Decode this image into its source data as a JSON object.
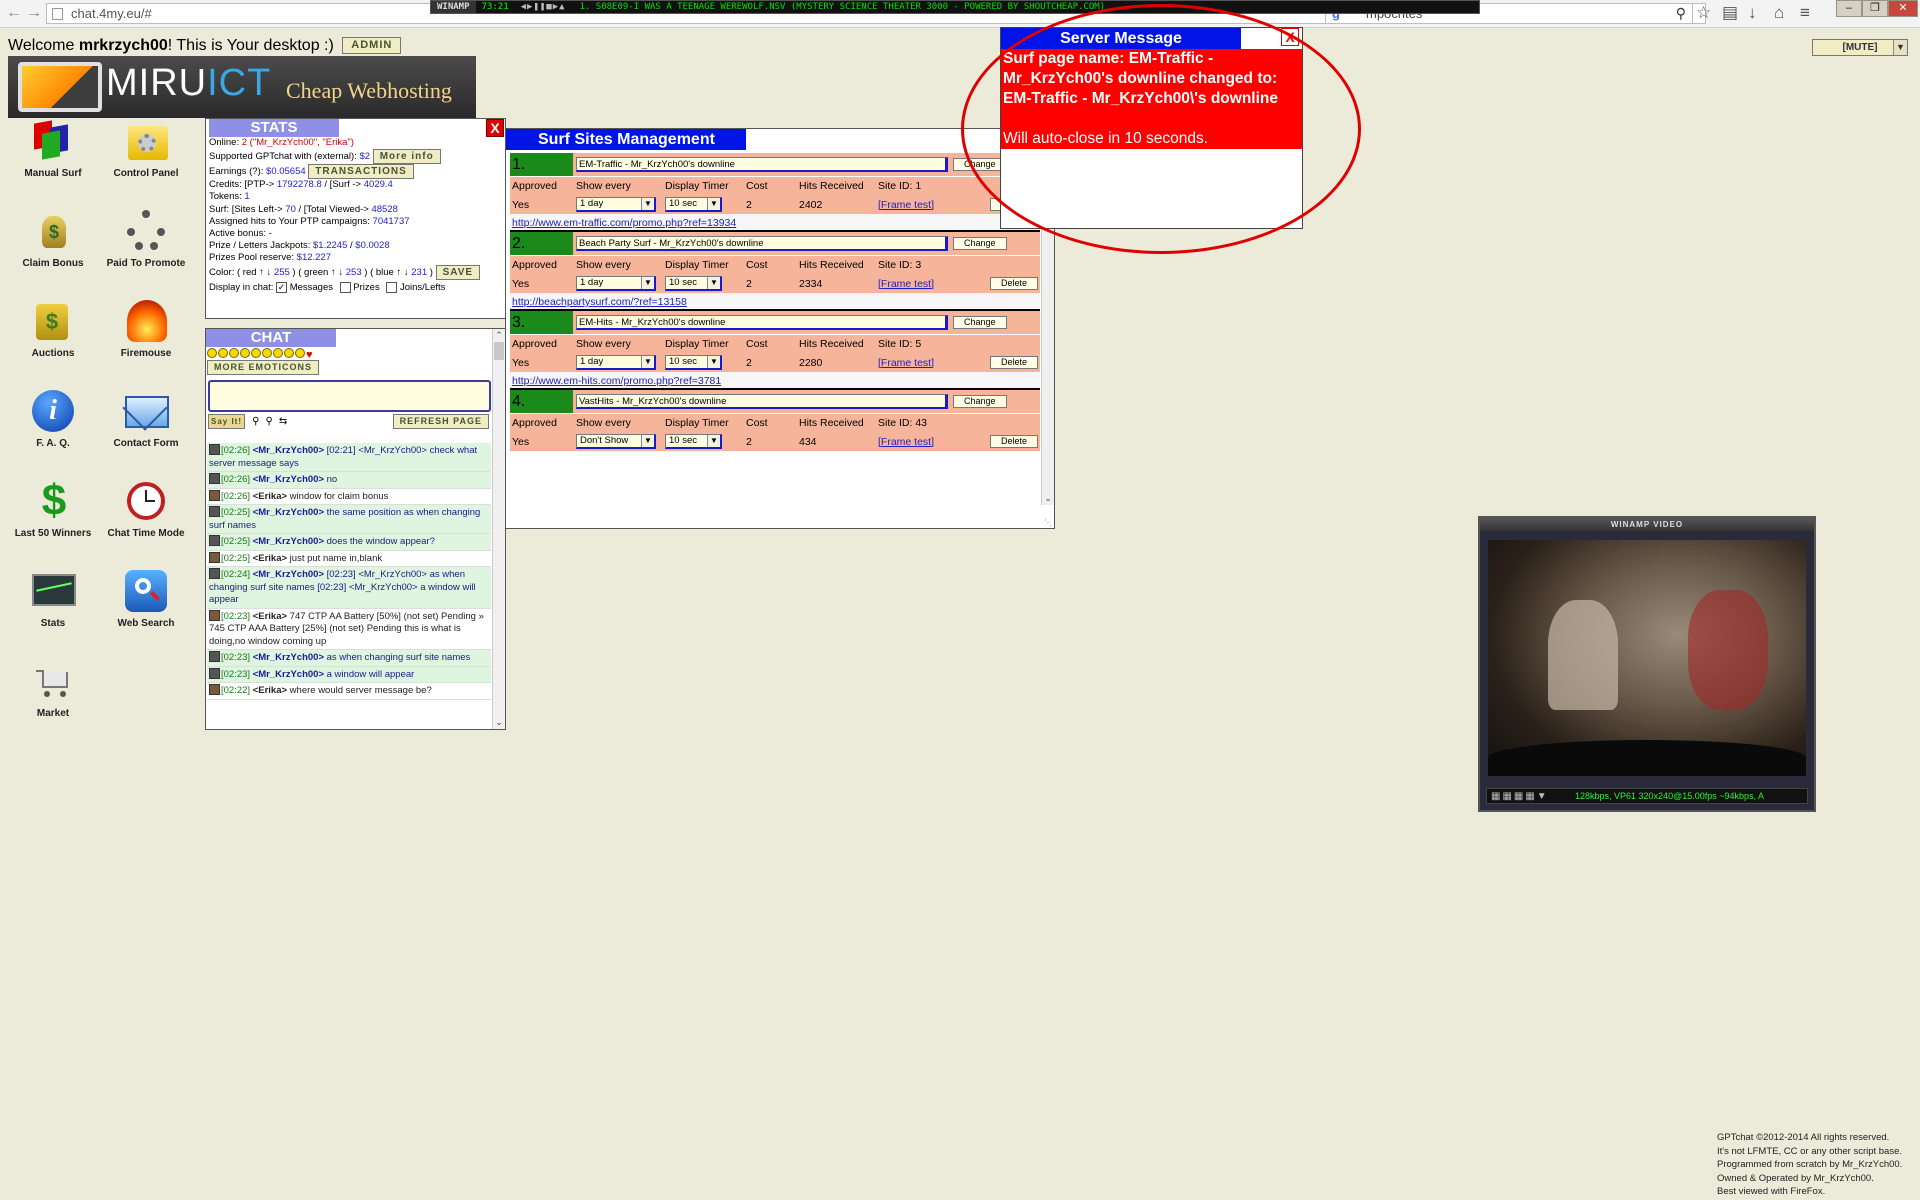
{
  "browser": {
    "url": "chat.4my.eu/#",
    "search_value": "mpochtes"
  },
  "winamp_bar": {
    "label": "WINAMP",
    "time": "73:21",
    "song": "1. S08E09-I WAS A TEENAGE WEREWOLF.NSV (MYSTERY SCIENCE THEATER 3000 - POWERED BY SHOUTCHEAP.COM)"
  },
  "header": {
    "welcome_prefix": "Welcome ",
    "username": "mrkrzych00",
    "welcome_suffix": "! This is Your desktop :)",
    "admin_label": "ADMIN",
    "mute_label": "[MUTE]"
  },
  "logo": {
    "brand_a": "MIRU",
    "brand_b": "ICT",
    "tagline": "Cheap Webhosting"
  },
  "desktop_icons": [
    {
      "label": "Manual Surf",
      "icon": "flags-icon"
    },
    {
      "label": "Control Panel",
      "icon": "folder-gear-icon"
    },
    {
      "label": "Claim Bonus",
      "icon": "money-bag-icon"
    },
    {
      "label": "Paid To Promote",
      "icon": "network-people-icon"
    },
    {
      "label": "Auctions",
      "icon": "auction-money-icon"
    },
    {
      "label": "Firemouse",
      "icon": "fire-icon"
    },
    {
      "label": "F. A. Q.",
      "icon": "info-icon"
    },
    {
      "label": "Contact Form",
      "icon": "envelope-icon"
    },
    {
      "label": "Last 50 Winners",
      "icon": "dollar-icon"
    },
    {
      "label": "Chat Time Mode",
      "icon": "alarm-clock-icon"
    },
    {
      "label": "Stats",
      "icon": "chart-monitor-icon"
    },
    {
      "label": "Web Search",
      "icon": "web-search-icon"
    },
    {
      "label": "Market",
      "icon": "cart-icon"
    }
  ],
  "stats": {
    "title": "STATS",
    "online_label": "Online: ",
    "online_count": "2",
    "online_users": " (\"Mr_KrzYch00\", \"Erika\")",
    "supported_label": "Supported GPTchat with (external): ",
    "supported_value": "$2",
    "more_info_label": "More info",
    "earnings_label": "Earnings (?): ",
    "earnings_value": "$0.05654",
    "transactions_label": "TRANSACTIONS",
    "credits_label": "Credits: [PTP-> ",
    "credits_ptp": "1792278.8",
    "credits_mid": " / [Surf -> ",
    "credits_surf": "4029.4",
    "tokens_label": "Tokens: ",
    "tokens_value": "1",
    "surf_label": "Surf: [Sites Left-> ",
    "sites_left": "70",
    "total_viewed_label": " / [Total Viewed-> ",
    "total_viewed": "48528",
    "assigned_label": "Assigned hits to Your PTP campaigns: ",
    "assigned_value": "7041737",
    "active_bonus": "Active bonus: -",
    "jackpot_label": "Prize / Letters Jackpots: ",
    "jackpot_prize": "$1.2245",
    "jackpot_sep": " / ",
    "jackpot_letters": "$0.0028",
    "pool_label": "Prizes Pool reserve: ",
    "pool_value": "$12.227",
    "color_label": "Color: ( red ↑ ↓ ",
    "red_value": "255",
    "green_label": " ) ( green ↑ ↓ ",
    "green_value": "253",
    "blue_label": " ) ( blue ↑ ↓ ",
    "blue_value": "231",
    "color_end": " )",
    "save_label": "SAVE",
    "display_label": "Display in chat: ",
    "messages_label": "Messages",
    "prizes_label": "Prizes",
    "joins_label": "Joins/Lefts",
    "messages_checked": true,
    "prizes_checked": false,
    "joins_checked": false
  },
  "chat": {
    "title": "CHAT",
    "more_emoticons_label": "MORE EMOTICONS",
    "say_label": "Say It!",
    "refresh_label": "REFRESH PAGE",
    "messages": [
      {
        "time": "[02:26]",
        "user": "<Mr_KrzYch00>",
        "text": " [02:21] <Mr_KrzYch00> check what server message says",
        "bg": "green",
        "self": true
      },
      {
        "time": "[02:26]",
        "user": "<Mr_KrzYch00>",
        "text": " no",
        "bg": "green",
        "self": true
      },
      {
        "time": "[02:26]",
        "user": "<Erika>",
        "text": " window for claim bonus",
        "bg": "white",
        "self": false
      },
      {
        "time": "[02:25]",
        "user": "<Mr_KrzYch00>",
        "text": " the same position as when changing surf names",
        "bg": "green",
        "self": true
      },
      {
        "time": "[02:25]",
        "user": "<Mr_KrzYch00>",
        "text": " does the window appear?",
        "bg": "green",
        "self": true
      },
      {
        "time": "[02:25]",
        "user": "<Erika>",
        "text": " just put name in,blank",
        "bg": "white",
        "self": false
      },
      {
        "time": "[02:24]",
        "user": "<Mr_KrzYch00>",
        "text": " [02:23] <Mr_KrzYch00> as when changing surf site names [02:23] <Mr_KrzYch00> a window will appear",
        "bg": "green",
        "self": true
      },
      {
        "time": "[02:23]",
        "user": "<Erika>",
        "text": " 747 CTP AA Battery [50%] (not set) Pending » 745 CTP AAA Battery [25%] (not set) Pending this is what is doing,no window coming up",
        "bg": "white",
        "self": false
      },
      {
        "time": "[02:23]",
        "user": "<Mr_KrzYch00>",
        "text": " as when changing surf site names",
        "bg": "green",
        "self": true
      },
      {
        "time": "[02:23]",
        "user": "<Mr_KrzYch00>",
        "text": " a window will appear",
        "bg": "green",
        "self": true
      },
      {
        "time": "[02:22]",
        "user": "<Erika>",
        "text": " where would server message be?",
        "bg": "white",
        "self": false
      }
    ]
  },
  "surf": {
    "title": "Surf Sites Management",
    "col_approved": "Approved",
    "col_show": "Show every",
    "col_timer": "Display Timer",
    "col_cost": "Cost",
    "col_hits": "Hits Received",
    "change_label": "Change",
    "delete_label": "Delete",
    "frame_test_label": "[Frame test]",
    "sites": [
      {
        "num": "1.",
        "name": "EM-Traffic - Mr_KrzYch00's downline",
        "approved": "Yes",
        "show": "1 day",
        "timer": "10 sec",
        "cost": "2",
        "hits": "2402",
        "site_id": "Site ID: 1",
        "url": "http://www.em-traffic.com/promo.php?ref=13934"
      },
      {
        "num": "2.",
        "name": "Beach Party Surf - Mr_KrzYch00's downline",
        "approved": "Yes",
        "show": "1 day",
        "timer": "10 sec",
        "cost": "2",
        "hits": "2334",
        "site_id": "Site ID: 3",
        "url": "http://beachpartysurf.com/?ref=13158"
      },
      {
        "num": "3.",
        "name": "EM-Hits - Mr_KrzYch00's downline",
        "approved": "Yes",
        "show": "1 day",
        "timer": "10 sec",
        "cost": "2",
        "hits": "2280",
        "site_id": "Site ID: 5",
        "url": "http://www.em-hits.com/promo.php?ref=3781"
      },
      {
        "num": "4.",
        "name": "VastHits - Mr_KrzYch00's downline",
        "approved": "Yes",
        "show": "Don't Show",
        "timer": "10 sec",
        "cost": "2",
        "hits": "434",
        "site_id": "Site ID: 43",
        "url": ""
      }
    ]
  },
  "server_message": {
    "title": "Server Message",
    "line1": "Surf page name: EM-Traffic - Mr_KrzYch00's downline changed to: EM-Traffic - Mr_KrzYch00\\'s downline",
    "line2": "Will auto-close in 10 seconds."
  },
  "video": {
    "title": "WINAMP VIDEO",
    "info": "128kbps, VP61 320x240@15.00fps ~94kbps, A"
  },
  "footer": {
    "lines": [
      "GPTchat ©2012-2014 All rights reserved.",
      "It's not LFMTE, CC or any other script base.",
      "Programmed from scratch by Mr_KrzYch00.",
      "Owned & Operated by Mr_KrzYch00.",
      "Best viewed with FireFox."
    ]
  },
  "colors": {
    "surf_header": "#0014e8",
    "server_body": "#ff0000",
    "stats_title": "#8f8fe8",
    "site_number_bg": "#1a8a1a",
    "row_bg": "#f6b49a",
    "desktop_bg": "#ecead8"
  }
}
